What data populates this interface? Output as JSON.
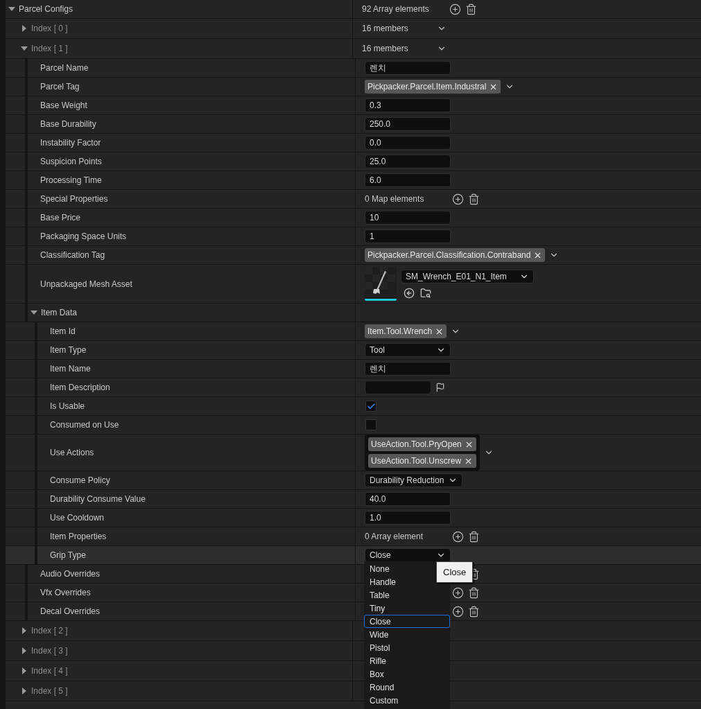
{
  "tree": [
    {
      "label": "Parcel Configs",
      "kind": "array",
      "expanded": true,
      "value": "92 Array elements",
      "children": [
        {
          "label": "Index [ 0 ]",
          "kind": "index",
          "expanded": false,
          "value": "16 members"
        },
        {
          "label": "Index [ 1 ]",
          "kind": "index",
          "expanded": true,
          "value": "16 members",
          "children": [
            {
              "label": "Parcel Name",
              "kind": "text",
              "value": "렌치"
            },
            {
              "label": "Parcel Tag",
              "kind": "tag",
              "tags": [
                "Pickpacker.Parcel.Item.Industral"
              ]
            },
            {
              "label": "Base Weight",
              "kind": "text",
              "value": "0.3"
            },
            {
              "label": "Base Durability",
              "kind": "text",
              "value": "250.0"
            },
            {
              "label": "Instability Factor",
              "kind": "text",
              "value": "0.0"
            },
            {
              "label": "Suspicion Points",
              "kind": "text",
              "value": "25.0"
            },
            {
              "label": "Processing Time",
              "kind": "text",
              "value": "6.0"
            },
            {
              "label": "Special Properties",
              "kind": "array",
              "value": "0 Map elements"
            },
            {
              "label": "Base Price",
              "kind": "text",
              "value": "10"
            },
            {
              "label": "Packaging Space Units",
              "kind": "text",
              "value": "1"
            },
            {
              "label": "Classification Tag",
              "kind": "tag",
              "tags": [
                "Pickpacker.Parcel.Classification.Contraband"
              ]
            },
            {
              "label": "Unpackaged Mesh Asset",
              "kind": "mesh",
              "value": "SM_Wrench_E01_N1_Item"
            },
            {
              "label": "Item Data",
              "kind": "struct",
              "expanded": true,
              "children": [
                {
                  "label": "Item Id",
                  "kind": "tag",
                  "tags": [
                    "Item.Tool.Wrench"
                  ]
                },
                {
                  "label": "Item Type",
                  "kind": "dropdown",
                  "value": "Tool"
                },
                {
                  "label": "Item Name",
                  "kind": "text",
                  "value": "렌치"
                },
                {
                  "label": "Item Description",
                  "kind": "text_flag"
                },
                {
                  "label": "Is Usable",
                  "kind": "checkbox",
                  "checked": true
                },
                {
                  "label": "Consumed on Use",
                  "kind": "checkbox",
                  "checked": false
                },
                {
                  "label": "Use Actions",
                  "kind": "tags",
                  "tags": [
                    "UseAction.Tool.PryOpen",
                    "UseAction.Tool.Unscrew"
                  ]
                },
                {
                  "label": "Consume Policy",
                  "kind": "dropdown",
                  "value": "Durability Reduction"
                },
                {
                  "label": "Durability Consume Value",
                  "kind": "text",
                  "value": "40.0"
                },
                {
                  "label": "Use Cooldown",
                  "kind": "text",
                  "value": "1.0"
                },
                {
                  "label": "Item Properties",
                  "kind": "array",
                  "value": "0 Array element"
                },
                {
                  "label": "Grip Type",
                  "kind": "dropdown",
                  "value": "Close",
                  "highlighted": true,
                  "open": true,
                  "tooltip": "Close",
                  "options": [
                    {
                      "label": "None",
                      "selected": false
                    },
                    {
                      "label": "Handle",
                      "selected": false
                    },
                    {
                      "label": "Table",
                      "selected": false
                    },
                    {
                      "label": "Tiny",
                      "selected": false
                    },
                    {
                      "label": "Close",
                      "selected": true
                    },
                    {
                      "label": "Wide",
                      "selected": false
                    },
                    {
                      "label": "Pistol",
                      "selected": false
                    },
                    {
                      "label": "Rifle",
                      "selected": false
                    },
                    {
                      "label": "Box",
                      "selected": false
                    },
                    {
                      "label": "Round",
                      "selected": false
                    },
                    {
                      "label": "Custom",
                      "selected": false
                    }
                  ]
                }
              ]
            },
            {
              "label": "Audio Overrides",
              "kind": "array"
            },
            {
              "label": "Vfx Overrides",
              "kind": "array"
            },
            {
              "label": "Decal Overrides",
              "kind": "array"
            }
          ]
        },
        {
          "label": "Index [ 2 ]",
          "kind": "index",
          "expanded": false
        },
        {
          "label": "Index [ 3 ]",
          "kind": "index",
          "expanded": false
        },
        {
          "label": "Index [ 4 ]",
          "kind": "index",
          "expanded": false
        },
        {
          "label": "Index [ 5 ]",
          "kind": "index",
          "expanded": false
        }
      ]
    }
  ]
}
